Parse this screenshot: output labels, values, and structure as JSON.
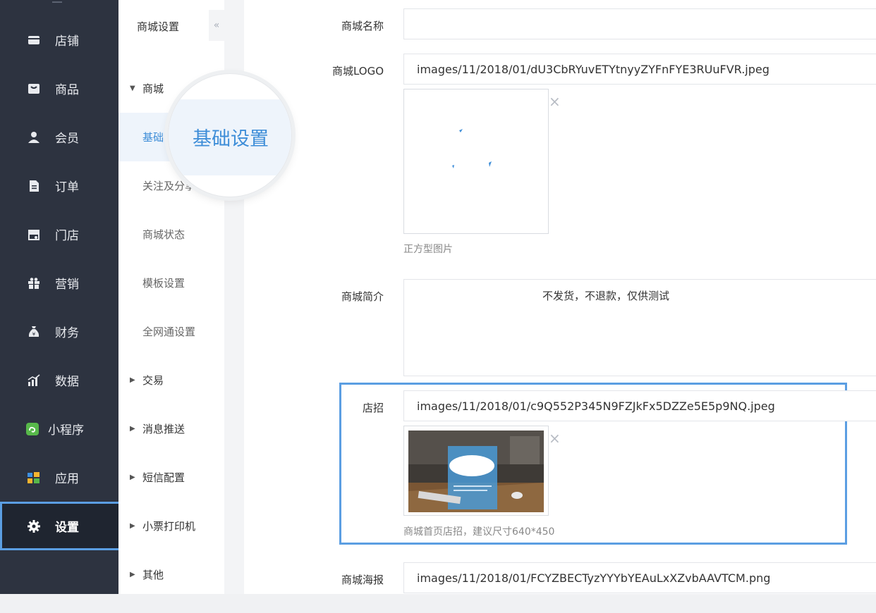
{
  "nav": {
    "items": [
      {
        "label": "店铺",
        "icon": "store-icon"
      },
      {
        "label": "商品",
        "icon": "goods-icon"
      },
      {
        "label": "会员",
        "icon": "member-icon"
      },
      {
        "label": "订单",
        "icon": "order-icon"
      },
      {
        "label": "门店",
        "icon": "shop-icon"
      },
      {
        "label": "营销",
        "icon": "gift-icon"
      },
      {
        "label": "财务",
        "icon": "money-bag-icon"
      },
      {
        "label": "数据",
        "icon": "chart-icon"
      },
      {
        "label": "小程序",
        "icon": "mini-program-icon"
      },
      {
        "label": "应用",
        "icon": "apps-icon"
      },
      {
        "label": "设置",
        "icon": "gear-icon"
      }
    ]
  },
  "subnav": {
    "title": "商城设置",
    "collapse_glyph": "«",
    "groups": [
      {
        "label": "商城",
        "expanded": true
      },
      {
        "label": "交易"
      },
      {
        "label": "消息推送"
      },
      {
        "label": "短信配置"
      },
      {
        "label": "小票打印机"
      },
      {
        "label": "其他"
      }
    ],
    "children": [
      "基础设置",
      "关注及分享",
      "商城状态",
      "模板设置",
      "全网通设置"
    ],
    "child_visible": [
      "基础",
      "关注及分享"
    ]
  },
  "magnifier": {
    "text": "基础设置"
  },
  "form": {
    "shop_name": {
      "label": "商城名称",
      "value": ""
    },
    "logo": {
      "label": "商城LOGO",
      "value": "images/11/2018/01/dU3CbRYuvETYtnyyZYFnFYE3RUuFVR.jpeg",
      "hint": "正方型图片"
    },
    "intro": {
      "label": "商城简介",
      "value": "不发货，不退款，仅供测试"
    },
    "banner": {
      "label": "店招",
      "value": "images/11/2018/01/c9Q552P345N9FZJkFx5DZZe5E5p9NQ.jpeg",
      "hint": "商城首页店招，建议尺寸640*450"
    },
    "poster": {
      "label": "商城海报",
      "value": "images/11/2018/01/FCYZBECTyzYYYbYEAuLxXZvbAAVTCM.png"
    },
    "close_glyph": "×"
  },
  "colors": {
    "nav_bg": "#2d3340",
    "accent": "#3f8ed8",
    "highlight": "#5b9ee2"
  }
}
